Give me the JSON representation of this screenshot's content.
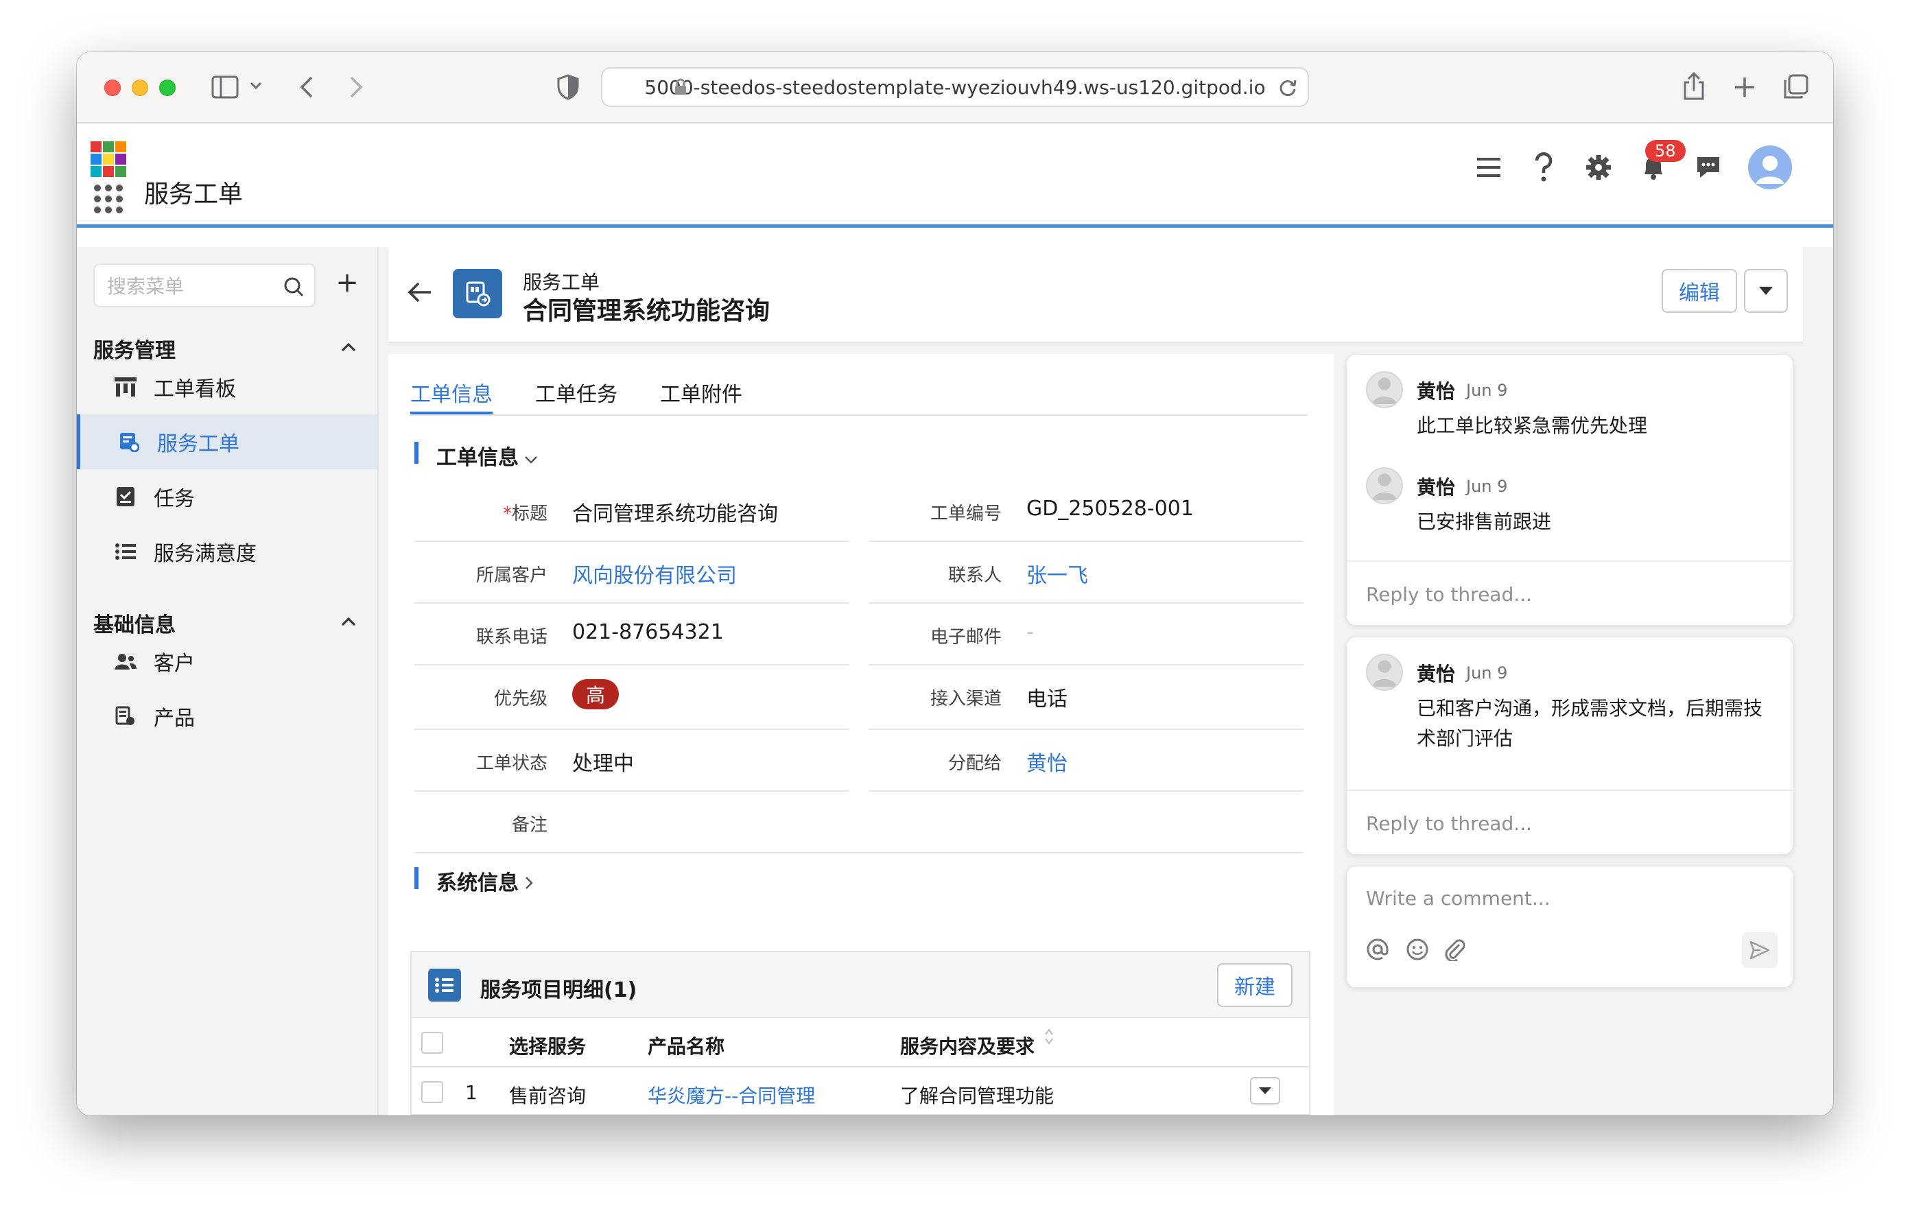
{
  "browser": {
    "url": "5000-steedos-steedostemplate-wyeziouvh49.ws-us120.gitpod.io"
  },
  "header": {
    "app_name": "服务工单",
    "notification_count": "58",
    "accent_color": "#4a90e2"
  },
  "sidebar": {
    "search_placeholder": "搜索菜单",
    "add_label": "+",
    "groups": [
      {
        "title": "服务管理",
        "items": [
          {
            "label": "工单看板",
            "icon": "kanban-icon"
          },
          {
            "label": "服务工单",
            "icon": "ticket-icon",
            "active": true
          },
          {
            "label": "任务",
            "icon": "task-icon"
          },
          {
            "label": "服务满意度",
            "icon": "list-icon"
          }
        ]
      },
      {
        "title": "基础信息",
        "items": [
          {
            "label": "客户",
            "icon": "customers-icon"
          },
          {
            "label": "产品",
            "icon": "product-icon"
          }
        ]
      }
    ]
  },
  "record": {
    "object_type": "服务工单",
    "title": "合同管理系统功能咨询",
    "edit_label": "编辑",
    "tabs": [
      "工单信息",
      "工单任务",
      "工单附件"
    ],
    "section_info": "工单信息",
    "section_system": "系统信息",
    "fields": {
      "title_label": "标题",
      "title_value": "合同管理系统功能咨询",
      "number_label": "工单编号",
      "number_value": "GD_250528-001",
      "customer_label": "所属客户",
      "customer_value": "风向股份有限公司",
      "contact_label": "联系人",
      "contact_value": "张一飞",
      "phone_label": "联系电话",
      "phone_value": "021-87654321",
      "email_label": "电子邮件",
      "email_value": "-",
      "priority_label": "优先级",
      "priority_value": "高",
      "channel_label": "接入渠道",
      "channel_value": "电话",
      "status_label": "工单状态",
      "status_value": "处理中",
      "assignee_label": "分配给",
      "assignee_value": "黄怡",
      "remark_label": "备注"
    },
    "related": {
      "title": "服务项目明细(1)",
      "new_label": "新建",
      "columns": [
        "选择服务",
        "产品名称",
        "服务内容及要求"
      ],
      "rows": [
        {
          "index": "1",
          "service": "售前咨询",
          "product": "华炎魔方--合同管理",
          "content": "了解合同管理功能"
        }
      ]
    }
  },
  "comments": {
    "threads": [
      {
        "messages": [
          {
            "author": "黄怡",
            "date": "Jun 9",
            "text": "此工单比较紧急需优先处理"
          },
          {
            "author": "黄怡",
            "date": "Jun 9",
            "text": "已安排售前跟进"
          }
        ],
        "reply_placeholder": "Reply to thread..."
      },
      {
        "messages": [
          {
            "author": "黄怡",
            "date": "Jun 9",
            "text": "已和客户沟通，形成需求文档，后期需技术部门评估"
          }
        ],
        "reply_placeholder": "Reply to thread..."
      }
    ],
    "composer_placeholder": "Write a comment..."
  }
}
